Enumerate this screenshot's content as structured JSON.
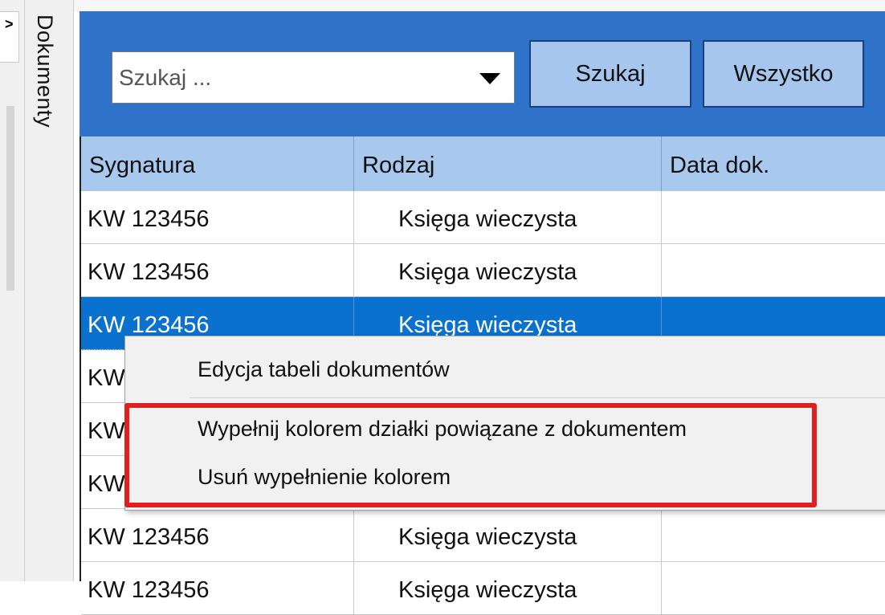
{
  "collapse_glyph": ">",
  "side_tab": {
    "label": "Dokumenty"
  },
  "toolbar": {
    "search_placeholder": "Szukaj ...",
    "search_value": "",
    "search_button": "Szukaj",
    "all_button": "Wszystko"
  },
  "table": {
    "columns": [
      "Sygnatura",
      "Rodzaj",
      "Data dok."
    ],
    "rows": [
      {
        "sygnatura": "KW 123456",
        "rodzaj": "Księga wieczysta",
        "data_dok": ""
      },
      {
        "sygnatura": "KW 123456",
        "rodzaj": "Księga wieczysta",
        "data_dok": ""
      },
      {
        "sygnatura": "KW 123456",
        "rodzaj": "Księga wieczysta",
        "data_dok": "",
        "selected": true
      },
      {
        "sygnatura": "KW",
        "rodzaj": "",
        "data_dok": ""
      },
      {
        "sygnatura": "KW",
        "rodzaj": "",
        "data_dok": ""
      },
      {
        "sygnatura": "KW",
        "rodzaj": "",
        "data_dok": ""
      },
      {
        "sygnatura": "KW 123456",
        "rodzaj": "Księga wieczysta",
        "data_dok": ""
      },
      {
        "sygnatura": "KW 123456",
        "rodzaj": "Księga wieczysta",
        "data_dok": ""
      }
    ]
  },
  "context_menu": {
    "items": [
      "Edycja tabeli dokumentów",
      "Wypełnij kolorem działki powiązane z dokumentem",
      "Usuń wypełnienie kolorem"
    ]
  },
  "colors": {
    "toolbar_bg": "#2f72c9",
    "header_bg": "#a9c8ee",
    "selected_row": "#0a71cf",
    "highlight": "#e01f1f"
  }
}
